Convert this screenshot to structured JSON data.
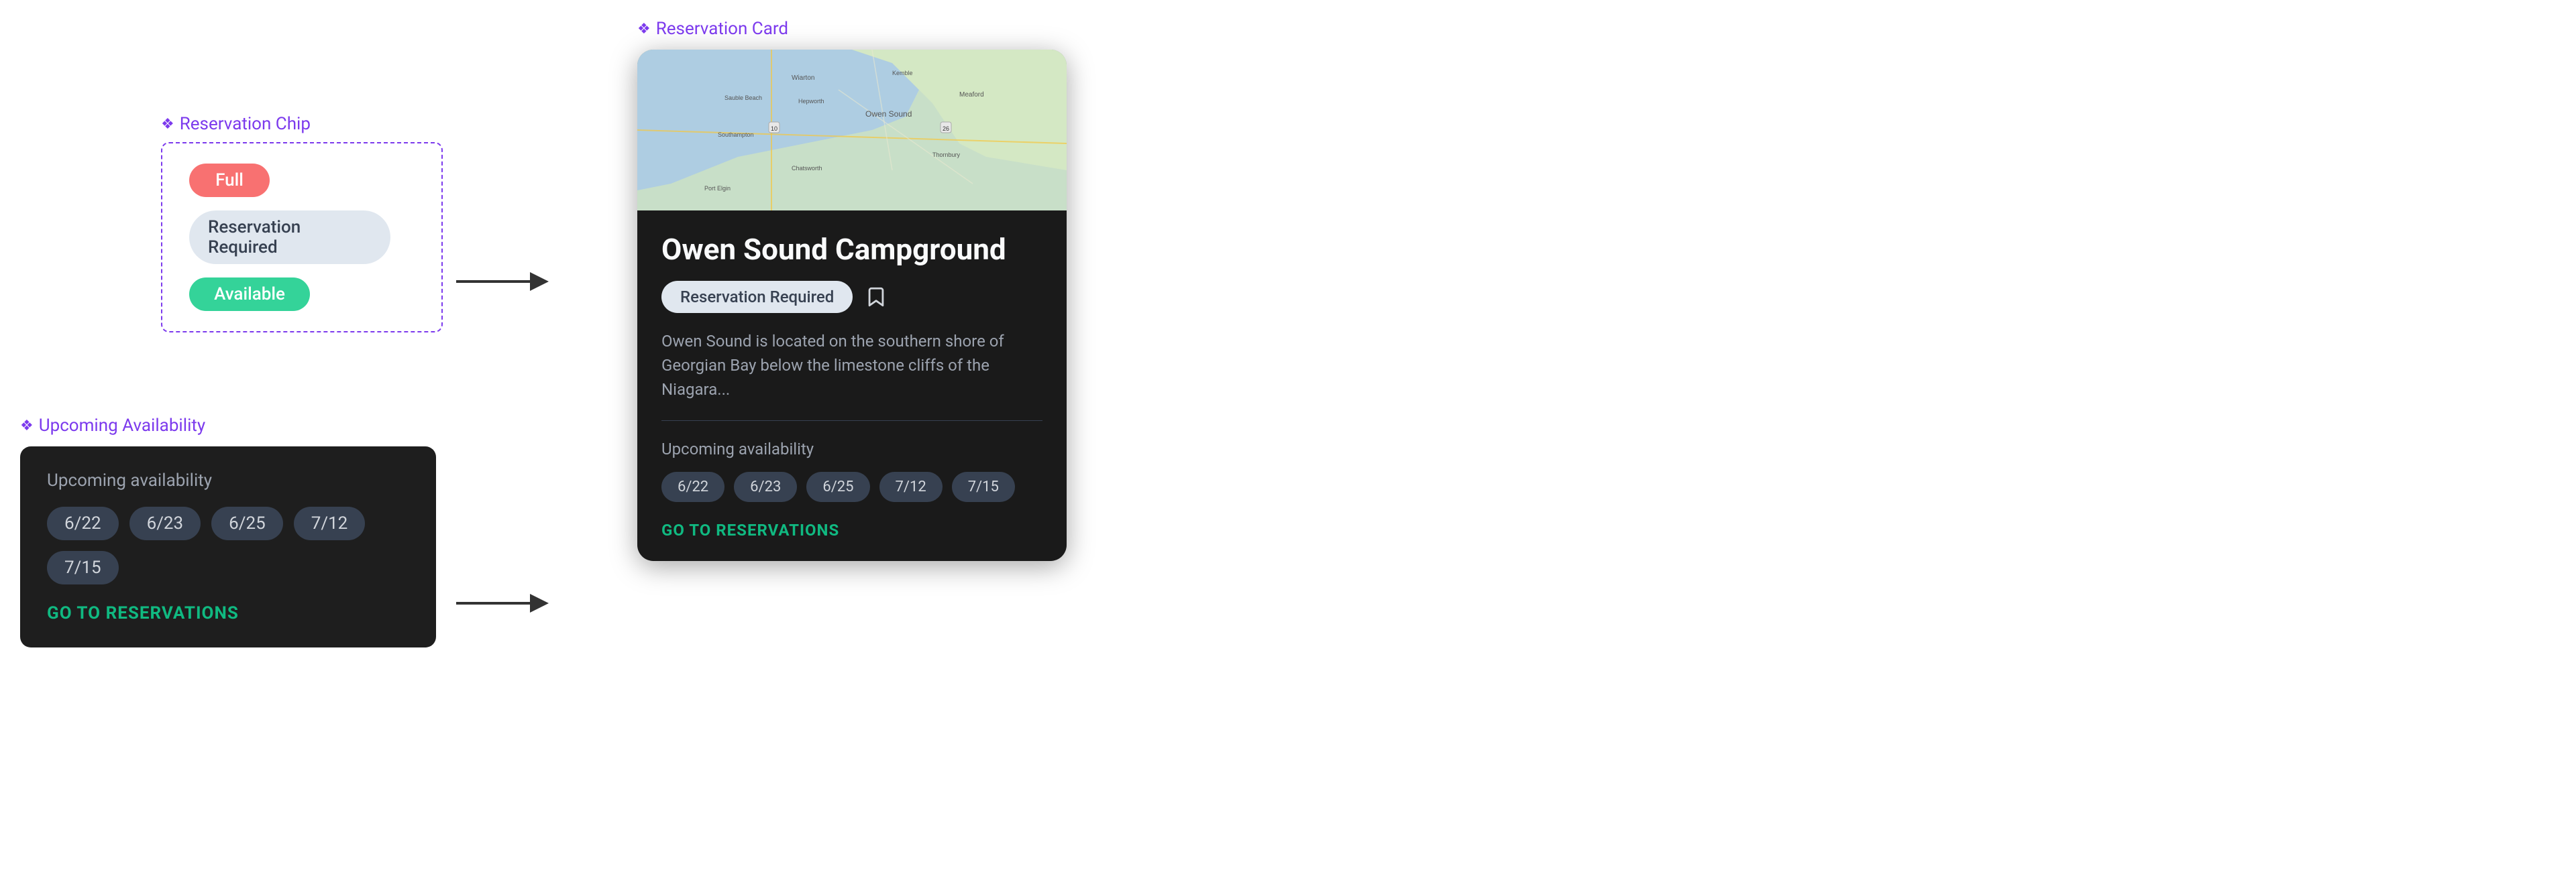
{
  "reservationChip": {
    "sectionLabel": "Reservation Chip",
    "chips": {
      "full": "Full",
      "reservationRequired": "Reservation Required",
      "available": "Available"
    }
  },
  "upcomingAvailability": {
    "sectionLabel": "Upcoming Availability",
    "cardTitle": "Upcoming availability",
    "dates": [
      "6/22",
      "6/23",
      "6/25",
      "7/12",
      "7/15"
    ],
    "goToReservations": "GO TO RESERVATIONS"
  },
  "reservationCard": {
    "sectionLabel": "Reservation Card",
    "campgroundName": "Owen Sound Campground",
    "chipLabel": "Reservation Required",
    "description": "Owen Sound is located on the southern shore of Georgian Bay below the limestone cliffs of the Niagara...",
    "upcomingTitle": "Upcoming availability",
    "dates": [
      "6/22",
      "6/23",
      "6/25",
      "7/12",
      "7/15"
    ],
    "goToReservations": "GO TO RESERVATIONS"
  },
  "arrows": {
    "arrowLabel": "→"
  }
}
